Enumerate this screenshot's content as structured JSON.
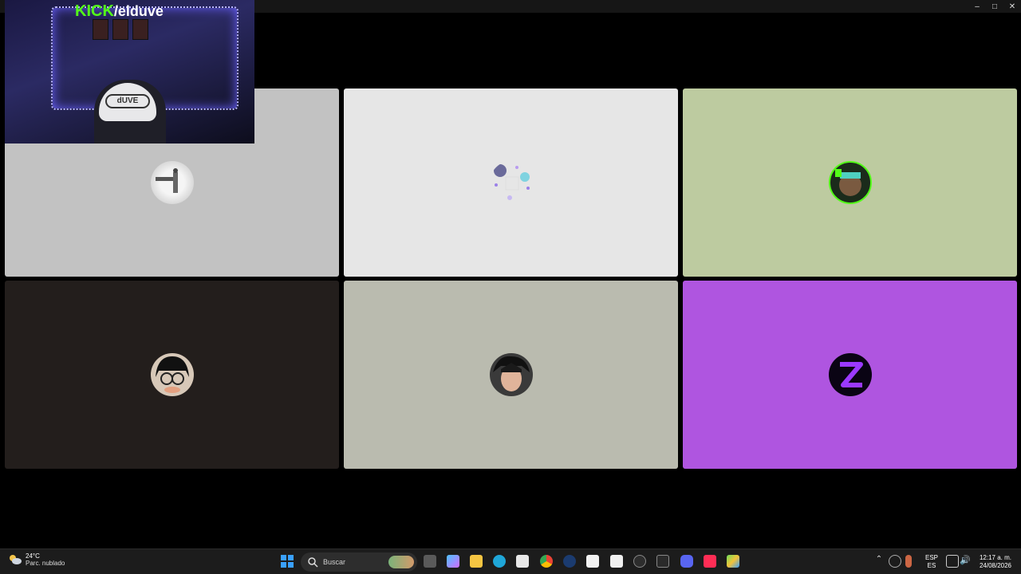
{
  "overlay": {
    "brand": "KICK",
    "user": "/elduve",
    "cap_text": "dUVE"
  },
  "taskbar": {
    "weather_temp": "24°C",
    "weather_desc": "Parc. nublado",
    "search_placeholder": "Buscar",
    "lang_top": "ESP",
    "lang_bottom": "ES",
    "time": "12:17 a. m.",
    "date": "24/08/2026"
  },
  "colors": {
    "tile1": "#c2c2c2",
    "tile2": "#e6e6e6",
    "tile3": "#bdcba0",
    "tile4": "#231e1c",
    "tile5": "#babbaf",
    "tile6": "#af55e0",
    "kick_green": "#53fc18"
  },
  "icons": [
    "windows-start-icon",
    "search-icon",
    "task-view-icon",
    "copilot-icon",
    "file-explorer-icon",
    "edge-icon",
    "store-icon",
    "chrome-icon",
    "steam-icon",
    "notepad-icon",
    "capcut-icon",
    "obs-icon",
    "epic-games-icon",
    "discord-icon",
    "tiktok-icon",
    "bluestacks-icon"
  ]
}
